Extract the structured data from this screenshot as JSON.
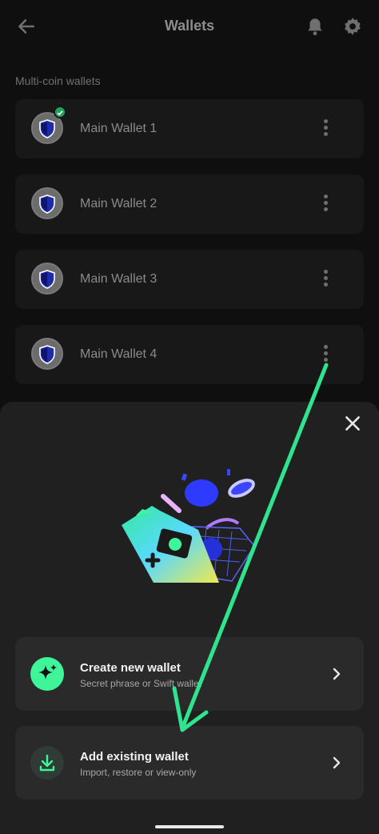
{
  "header": {
    "title": "Wallets"
  },
  "section_label": "Multi-coin wallets",
  "wallets": [
    {
      "name": "Main Wallet 1",
      "selected": true
    },
    {
      "name": "Main Wallet 2",
      "selected": false
    },
    {
      "name": "Main Wallet 3",
      "selected": false
    },
    {
      "name": "Main Wallet 4",
      "selected": false
    }
  ],
  "sheet": {
    "options": [
      {
        "title": "Create new wallet",
        "subtitle": "Secret phrase or Swift wallet",
        "icon": "sparkle-icon"
      },
      {
        "title": "Add existing wallet",
        "subtitle": "Import, restore or view-only",
        "icon": "download-icon"
      }
    ]
  },
  "colors": {
    "accent": "#3ff59a",
    "arrow": "#2fe38f",
    "shield": "#1f2aa8"
  }
}
